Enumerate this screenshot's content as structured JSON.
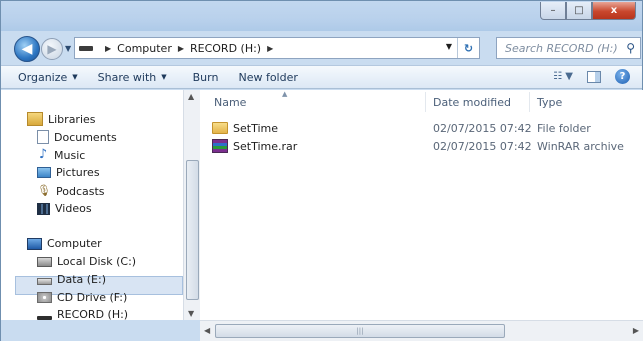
{
  "window": {
    "controls": {
      "minimize": "–",
      "maximize": "□",
      "close": "x"
    }
  },
  "nav": {
    "breadcrumb": [
      "Computer",
      "RECORD (H:)"
    ],
    "search_placeholder": "Search RECORD (H:)"
  },
  "toolbar": {
    "organize": "Organize",
    "share_with": "Share with",
    "burn": "Burn",
    "new_folder": "New folder"
  },
  "sidebar": {
    "libraries": "Libraries",
    "library_items": [
      "Documents",
      "Music",
      "Pictures",
      "Podcasts",
      "Videos"
    ],
    "computer": "Computer",
    "drives": [
      "Local Disk (C:)",
      "Data (E:)",
      "CD Drive (F:)",
      "RECORD (H:)"
    ],
    "selected": "RECORD (H:)"
  },
  "columns": {
    "name": "Name",
    "date": "Date modified",
    "type": "Type"
  },
  "files": [
    {
      "name": "SetTime",
      "date": "02/07/2015 07:42",
      "type": "File folder",
      "icon": "folder-icon"
    },
    {
      "name": "SetTime.rar",
      "date": "02/07/2015 07:42",
      "type": "WinRAR archive",
      "icon": "winrar-icon"
    }
  ]
}
